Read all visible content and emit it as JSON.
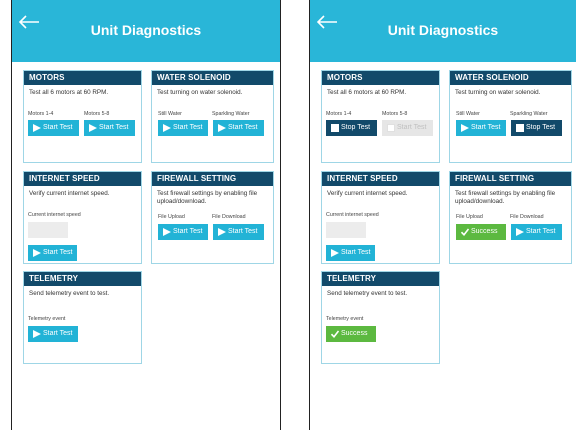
{
  "title": "Unit Diagnostics",
  "colors": {
    "header": "#29b6d8",
    "card_header": "#124a6a",
    "button": "#22b3d6",
    "success": "#5cb940"
  },
  "cards": {
    "motors": {
      "title": "MOTORS",
      "desc": "Test all 6 motors at 60 RPM.",
      "label_1": "Motors 1-4",
      "label_2": "Motors 5-8"
    },
    "solenoid": {
      "title": "WATER SOLENOID",
      "desc": "Test turning on water solenoid.",
      "label_1": "Still Water",
      "label_2": "Sparkling Water"
    },
    "internet": {
      "title": "INTERNET SPEED",
      "desc": "Verify current internet speed.",
      "label_1": "Current internet speed"
    },
    "firewall": {
      "title": "FIREWALL SETTING",
      "desc": "Test firewall settings by enabling file upload/download.",
      "label_1": "File Upload",
      "label_2": "File Download"
    },
    "telemetry": {
      "title": "TELEMETRY",
      "desc": "Send telemetry event to test.",
      "label_1": "Telemetry event"
    }
  },
  "buttons": {
    "start": "Start Test",
    "stop": "Stop Test",
    "success": "Success"
  },
  "icons": {
    "back": "back-arrow-icon",
    "play": "play-icon",
    "stop": "stop-icon",
    "check": "check-icon"
  }
}
